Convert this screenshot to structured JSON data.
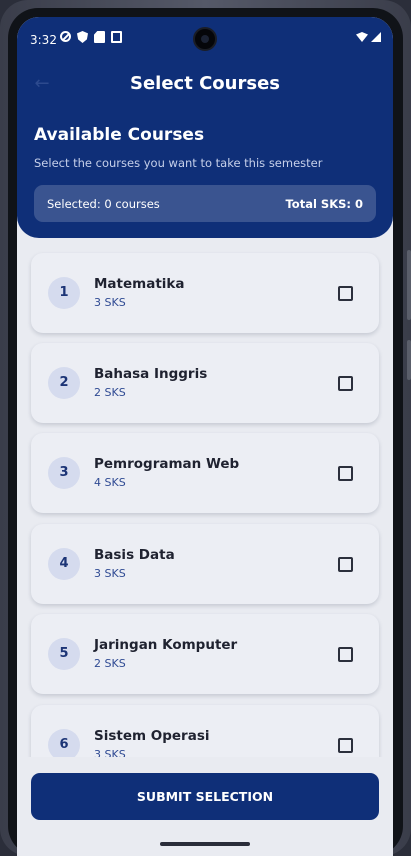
{
  "status_bar": {
    "time": "3:32"
  },
  "appbar": {
    "title": "Select Courses",
    "back_icon": "arrow-left-icon"
  },
  "header": {
    "section_title": "Available Courses",
    "section_subtitle": "Select the courses you want to take this semester",
    "selected_text": "Selected: 0 courses",
    "total_text": "Total SKS: 0"
  },
  "courses": [
    {
      "number": "1",
      "name": "Matematika",
      "sks": "3 SKS",
      "checked": false
    },
    {
      "number": "2",
      "name": "Bahasa Inggris",
      "sks": "2 SKS",
      "checked": false
    },
    {
      "number": "3",
      "name": "Pemrograman Web",
      "sks": "4 SKS",
      "checked": false
    },
    {
      "number": "4",
      "name": "Basis Data",
      "sks": "3 SKS",
      "checked": false
    },
    {
      "number": "5",
      "name": "Jaringan Komputer",
      "sks": "2 SKS",
      "checked": false
    },
    {
      "number": "6",
      "name": "Sistem Operasi",
      "sks": "3 SKS",
      "checked": false
    }
  ],
  "submit": {
    "label": "SUBMIT SELECTION"
  },
  "colors": {
    "primary": "#0f2f78",
    "background": "#e9ebf1",
    "card": "#eceef4",
    "accent_text": "#2f4a93"
  }
}
